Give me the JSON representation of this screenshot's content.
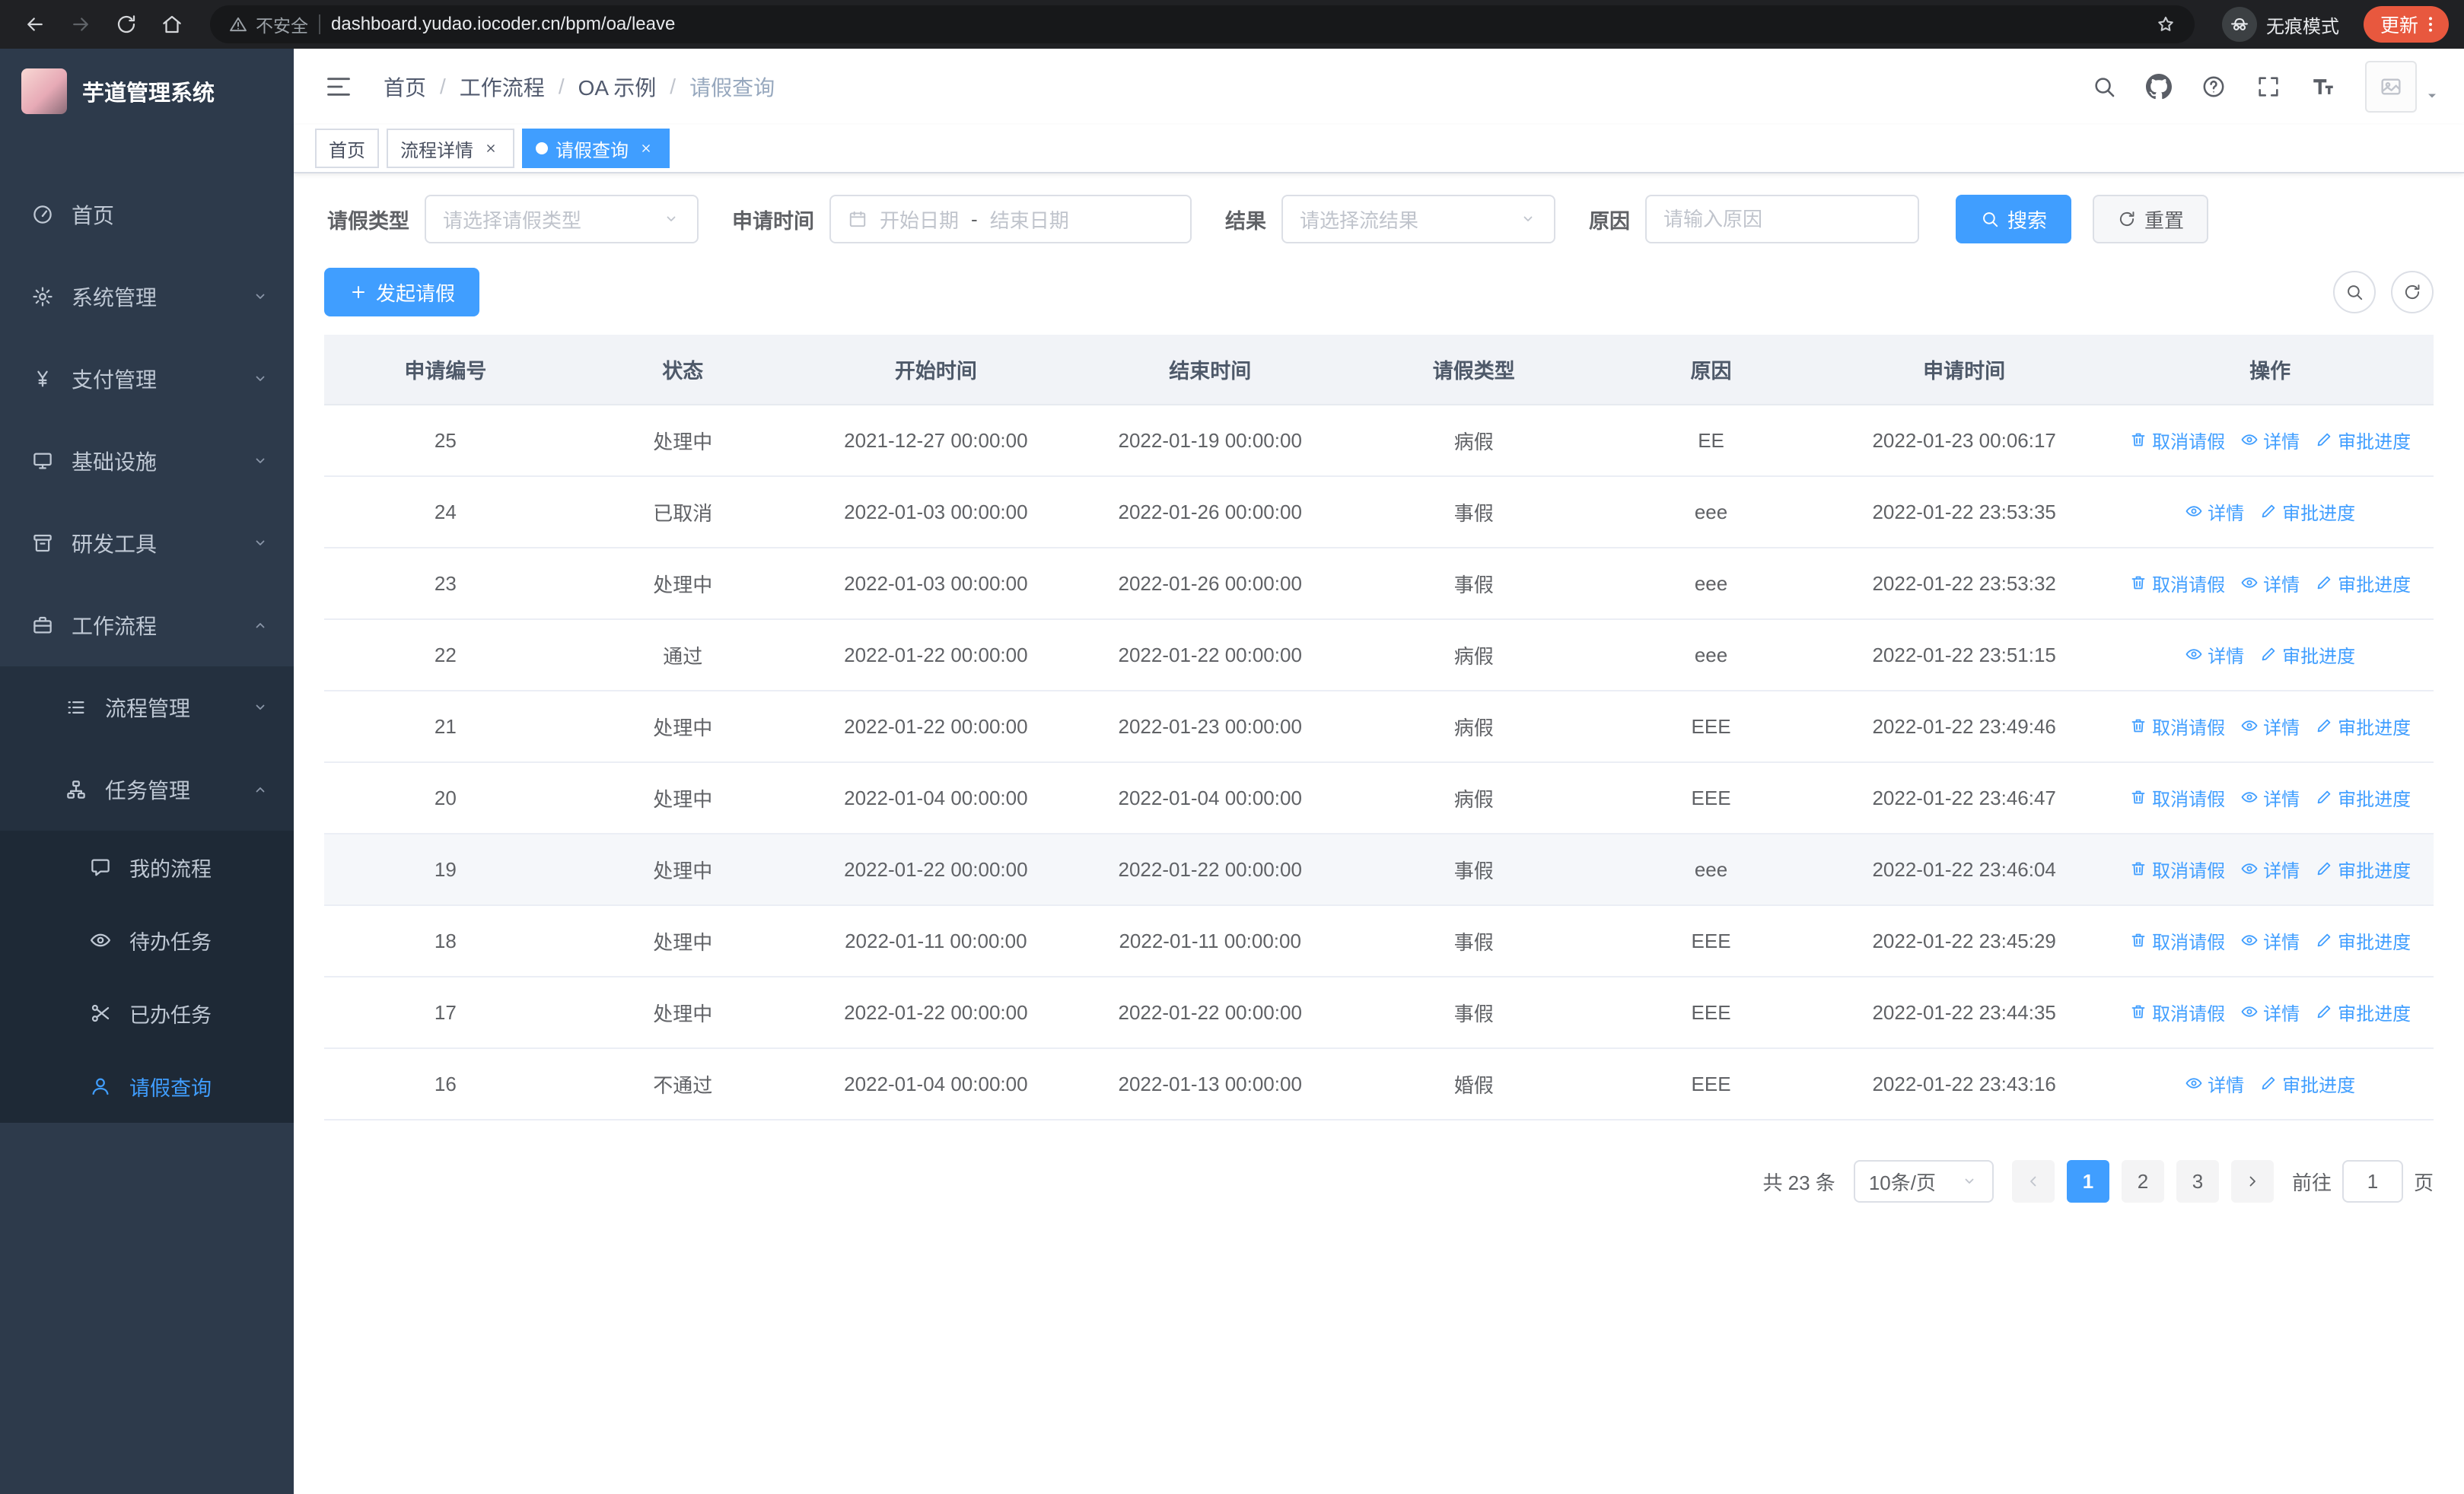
{
  "colors": {
    "accent": "#409eff",
    "update_badge": "#e8583e",
    "browser_bar_bg": "#202124",
    "address_bar_bg": "#17181a",
    "sidebar_bg": "#2d3a4b",
    "sidebar_sub_bg": "#24303f",
    "sidebar_deep_bg": "#1e2936"
  },
  "browser": {
    "security_label": "不安全",
    "url": "dashboard.yudao.iocoder.cn/bpm/oa/leave",
    "incognito_label": "无痕模式",
    "update_label": "更新"
  },
  "sidebar": {
    "logo_title": "芋道管理系统",
    "menu": [
      {
        "key": "home",
        "label": "首页",
        "icon": "dashboard-icon"
      },
      {
        "key": "system",
        "label": "系统管理",
        "icon": "gear-icon",
        "expandable": true
      },
      {
        "key": "payment",
        "label": "支付管理",
        "icon": "yen-icon",
        "expandable": true
      },
      {
        "key": "infrastructure",
        "label": "基础设施",
        "icon": "infra-icon",
        "expandable": true
      },
      {
        "key": "devtools",
        "label": "研发工具",
        "icon": "tools-icon",
        "expandable": true
      },
      {
        "key": "workflow",
        "label": "工作流程",
        "icon": "workflow-icon",
        "expandable": true,
        "expanded": true,
        "children": [
          {
            "key": "process-mgmt",
            "label": "流程管理",
            "icon": "process-icon",
            "expandable": true
          },
          {
            "key": "task-mgmt",
            "label": "任务管理",
            "icon": "task-icon",
            "expandable": true,
            "expanded": true,
            "children": [
              {
                "key": "my-process",
                "label": "我的流程",
                "icon": "chat-icon"
              },
              {
                "key": "todo-tasks",
                "label": "待办任务",
                "icon": "eye-icon"
              },
              {
                "key": "done-tasks",
                "label": "已办任务",
                "icon": "scissors-icon"
              },
              {
                "key": "leave-query",
                "label": "请假查询",
                "icon": "user-icon",
                "active": true
              }
            ]
          }
        ]
      }
    ]
  },
  "header": {
    "breadcrumb": [
      "首页",
      "工作流程",
      "OA 示例",
      "请假查询"
    ]
  },
  "tabs": [
    {
      "key": "home",
      "label": "首页",
      "closable": false,
      "active": false
    },
    {
      "key": "process-detail",
      "label": "流程详情",
      "closable": true,
      "active": false
    },
    {
      "key": "leave-query",
      "label": "请假查询",
      "closable": true,
      "active": true
    }
  ],
  "filters": {
    "leave_type_label": "请假类型",
    "leave_type_placeholder": "请选择请假类型",
    "apply_time_label": "申请时间",
    "start_date_placeholder": "开始日期",
    "range_separator": "-",
    "end_date_placeholder": "结束日期",
    "result_label": "结果",
    "result_placeholder": "请选择流结果",
    "reason_label": "原因",
    "reason_placeholder": "请输入原因",
    "search_label": "搜索",
    "reset_label": "重置"
  },
  "toolbar": {
    "create_label": "发起请假"
  },
  "table": {
    "columns": [
      "申请编号",
      "状态",
      "开始时间",
      "结束时间",
      "请假类型",
      "原因",
      "申请时间",
      "操作"
    ],
    "action_labels": {
      "cancel": "取消请假",
      "detail": "详情",
      "progress": "审批进度"
    },
    "rows": [
      {
        "id": "25",
        "status": "处理中",
        "start": "2021-12-27 00:00:00",
        "end": "2022-01-19 00:00:00",
        "type": "病假",
        "reason": "EE",
        "applied": "2022-01-23 00:06:17",
        "actions": [
          "cancel",
          "detail",
          "progress"
        ]
      },
      {
        "id": "24",
        "status": "已取消",
        "start": "2022-01-03 00:00:00",
        "end": "2022-01-26 00:00:00",
        "type": "事假",
        "reason": "eee",
        "applied": "2022-01-22 23:53:35",
        "actions": [
          "detail",
          "progress"
        ]
      },
      {
        "id": "23",
        "status": "处理中",
        "start": "2022-01-03 00:00:00",
        "end": "2022-01-26 00:00:00",
        "type": "事假",
        "reason": "eee",
        "applied": "2022-01-22 23:53:32",
        "actions": [
          "cancel",
          "detail",
          "progress"
        ]
      },
      {
        "id": "22",
        "status": "通过",
        "start": "2022-01-22 00:00:00",
        "end": "2022-01-22 00:00:00",
        "type": "病假",
        "reason": "eee",
        "applied": "2022-01-22 23:51:15",
        "actions": [
          "detail",
          "progress"
        ]
      },
      {
        "id": "21",
        "status": "处理中",
        "start": "2022-01-22 00:00:00",
        "end": "2022-01-23 00:00:00",
        "type": "病假",
        "reason": "EEE",
        "applied": "2022-01-22 23:49:46",
        "actions": [
          "cancel",
          "detail",
          "progress"
        ]
      },
      {
        "id": "20",
        "status": "处理中",
        "start": "2022-01-04 00:00:00",
        "end": "2022-01-04 00:00:00",
        "type": "病假",
        "reason": "EEE",
        "applied": "2022-01-22 23:46:47",
        "actions": [
          "cancel",
          "detail",
          "progress"
        ]
      },
      {
        "id": "19",
        "status": "处理中",
        "start": "2022-01-22 00:00:00",
        "end": "2022-01-22 00:00:00",
        "type": "事假",
        "reason": "eee",
        "applied": "2022-01-22 23:46:04",
        "actions": [
          "cancel",
          "detail",
          "progress"
        ],
        "highlighted": true
      },
      {
        "id": "18",
        "status": "处理中",
        "start": "2022-01-11 00:00:00",
        "end": "2022-01-11 00:00:00",
        "type": "事假",
        "reason": "EEE",
        "applied": "2022-01-22 23:45:29",
        "actions": [
          "cancel",
          "detail",
          "progress"
        ]
      },
      {
        "id": "17",
        "status": "处理中",
        "start": "2022-01-22 00:00:00",
        "end": "2022-01-22 00:00:00",
        "type": "事假",
        "reason": "EEE",
        "applied": "2022-01-22 23:44:35",
        "actions": [
          "cancel",
          "detail",
          "progress"
        ]
      },
      {
        "id": "16",
        "status": "不通过",
        "start": "2022-01-04 00:00:00",
        "end": "2022-01-13 00:00:00",
        "type": "婚假",
        "reason": "EEE",
        "applied": "2022-01-22 23:43:16",
        "actions": [
          "detail",
          "progress"
        ]
      }
    ]
  },
  "pagination": {
    "total_label": "共 23 条",
    "page_size_label": "10条/页",
    "pages": [
      "1",
      "2",
      "3"
    ],
    "active_page": "1",
    "goto_label": "前往",
    "goto_value": "1",
    "goto_unit": "页"
  }
}
